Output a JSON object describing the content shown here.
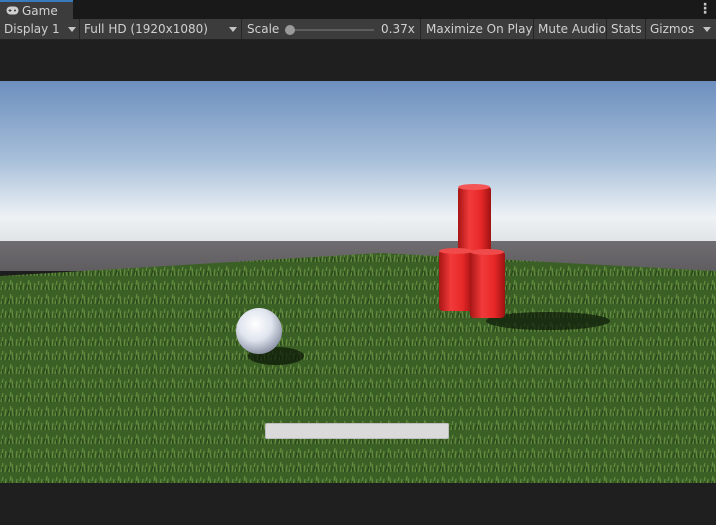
{
  "window": {
    "tab_label": "Game",
    "tab_icon": "gamepad-icon",
    "menu_icon": "kebab-menu-icon"
  },
  "toolbar": {
    "display_label": "Display 1",
    "resolution_label": "Full HD (1920x1080)",
    "scale_label": "Scale",
    "scale_value": 0.37,
    "scale_value_text": "0.37x",
    "maximize_label": "Maximize On Play",
    "mute_label": "Mute Audio",
    "stats_label": "Stats",
    "gizmos_label": "Gizmos"
  },
  "colors": {
    "accent": "#3a79bb",
    "panel": "#3c3c3c",
    "background": "#1e1e1e"
  },
  "scene": {
    "objects": [
      "white-sphere",
      "red-cylinder-stack",
      "grass-ground",
      "sky",
      "ui-bar"
    ]
  }
}
